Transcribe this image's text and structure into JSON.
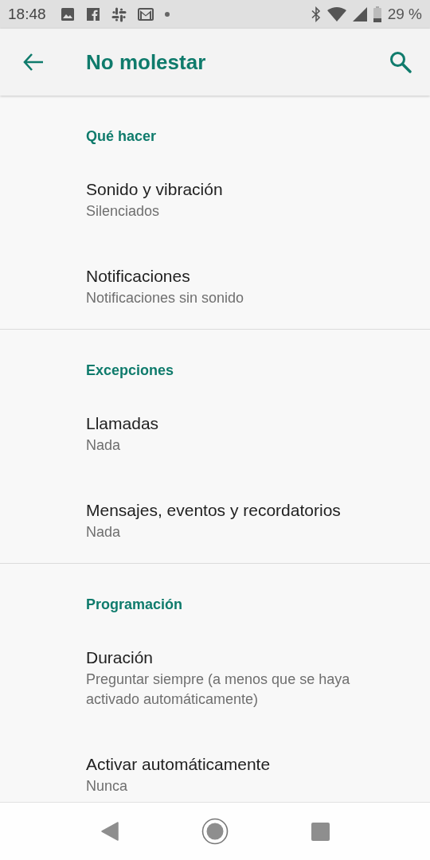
{
  "status_bar": {
    "time": "18:48",
    "battery": "29 %"
  },
  "app_bar": {
    "title": "No molestar"
  },
  "sections": [
    {
      "heading": "Qué hacer",
      "items": [
        {
          "title": "Sonido y vibración",
          "subtitle": "Silenciados"
        },
        {
          "title": "Notificaciones",
          "subtitle": "Notificaciones sin sonido"
        }
      ]
    },
    {
      "heading": "Excepciones",
      "items": [
        {
          "title": "Llamadas",
          "subtitle": "Nada"
        },
        {
          "title": "Mensajes, eventos y recordatorios",
          "subtitle": "Nada"
        }
      ]
    },
    {
      "heading": "Programación",
      "items": [
        {
          "title": "Duración",
          "subtitle": "Preguntar siempre (a menos que se haya activado automáticamente)"
        },
        {
          "title": "Activar automáticamente",
          "subtitle": "Nunca"
        }
      ]
    }
  ]
}
